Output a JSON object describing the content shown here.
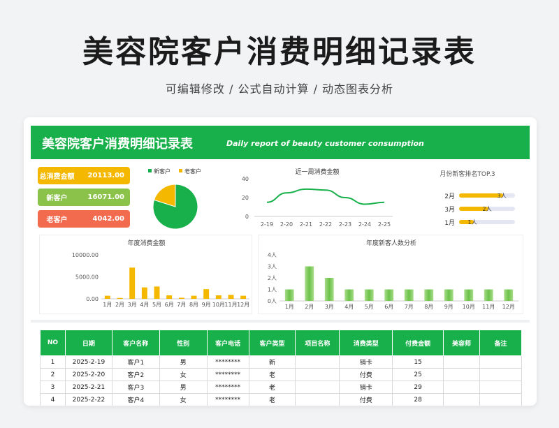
{
  "page": {
    "title": "美容院客户消费明细记录表",
    "subtitle": "可编辑修改 /  公式自动计算  /  动态图表分析"
  },
  "banner": {
    "title": "美容院客户消费明细记录表",
    "subtitle_en": "Daily report of beauty customer consumption"
  },
  "kpis": [
    {
      "label": "总消费金额",
      "value": "20113.00",
      "color": "#f5b800"
    },
    {
      "label": "新客户",
      "value": "16071.00",
      "color": "#8bc34a"
    },
    {
      "label": "老客户",
      "value": "4042.00",
      "color": "#f26b4f"
    }
  ],
  "pie": {
    "legend": [
      "新客户",
      "老客户"
    ],
    "colors": [
      "#18b04a",
      "#f5b800"
    ],
    "values": [
      16071,
      4042
    ]
  },
  "chart_data": [
    {
      "type": "line",
      "title": "近一周消费金额",
      "categories": [
        "2-19",
        "2-20",
        "2-21",
        "2-22",
        "2-23",
        "2-24",
        "2-25"
      ],
      "values": [
        15,
        25,
        29,
        28,
        20,
        13,
        15
      ],
      "yticks": [
        "0",
        "20",
        "40"
      ],
      "ylim": [
        0,
        40
      ],
      "color": "#18b04a"
    },
    {
      "type": "bar",
      "title": "月份新客排名TOP.3",
      "categories": [
        "2月",
        "3月",
        "1月"
      ],
      "values": [
        3,
        2,
        1
      ],
      "value_labels": [
        "3人",
        "2人",
        "1人"
      ],
      "xlim": [
        0,
        3.8
      ],
      "color": "#f5b800",
      "track_color": "#e4e6f4"
    },
    {
      "type": "bar",
      "title": "年度消费金额",
      "categories": [
        "1月",
        "2月",
        "3月",
        "4月",
        "5月",
        "6月",
        "7月",
        "8月",
        "9月",
        "10月",
        "11月",
        "12月"
      ],
      "values": [
        700,
        200,
        7100,
        2600,
        2800,
        800,
        250,
        700,
        2200,
        800,
        900,
        700
      ],
      "yticks": [
        "0.00",
        "5000.00",
        "10000.00"
      ],
      "ylim": [
        0,
        10000
      ],
      "color": "#f5b800"
    },
    {
      "type": "bar",
      "title": "年度新客人数分析",
      "categories": [
        "1月",
        "2月",
        "3月",
        "4月",
        "5月",
        "6月",
        "7月",
        "8月",
        "9月",
        "10月",
        "11月",
        "12月"
      ],
      "values": [
        1,
        3,
        2,
        1,
        1,
        1,
        1,
        1,
        1,
        1,
        1,
        1
      ],
      "yticks": [
        "0人",
        "1人",
        "2人",
        "3人",
        "4人"
      ],
      "ylim": [
        0,
        4
      ],
      "color": "#6cc24a"
    }
  ],
  "table": {
    "headers": [
      "NO",
      "日期",
      "客户名称",
      "性别",
      "客户电话",
      "客户类型",
      "项目名称",
      "消费类型",
      "付费金额",
      "美容师",
      "备注"
    ],
    "rows": [
      [
        "1",
        "2025-2-19",
        "客户1",
        "男",
        "********",
        "新",
        "",
        "销卡",
        "15",
        "",
        ""
      ],
      [
        "2",
        "2025-2-20",
        "客户2",
        "女",
        "********",
        "老",
        "",
        "付费",
        "25",
        "",
        ""
      ],
      [
        "3",
        "2025-2-21",
        "客户3",
        "男",
        "********",
        "老",
        "",
        "销卡",
        "29",
        "",
        ""
      ],
      [
        "4",
        "2025-2-22",
        "客户4",
        "女",
        "********",
        "老",
        "",
        "付费",
        "28",
        "",
        ""
      ]
    ]
  }
}
